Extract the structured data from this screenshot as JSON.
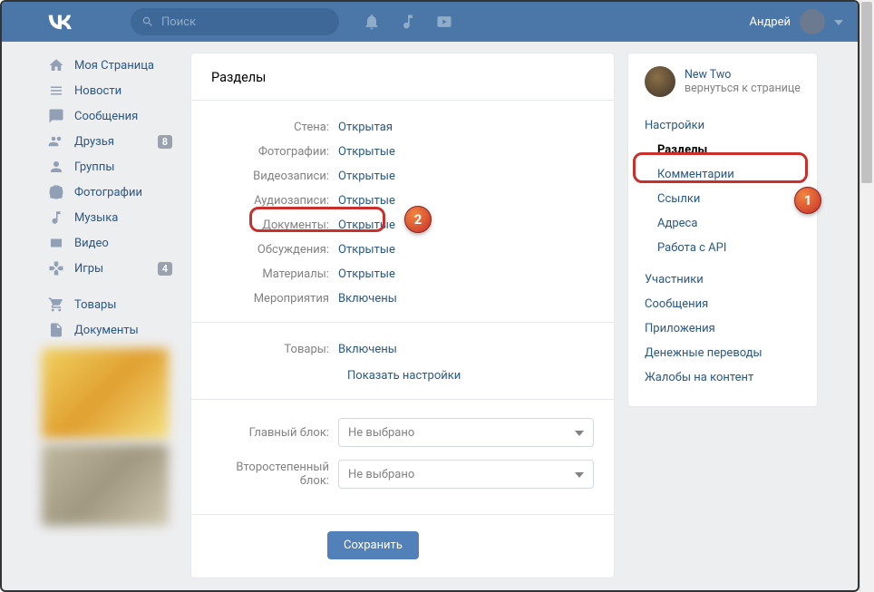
{
  "header": {
    "search_placeholder": "Поиск",
    "user_name": "Андрей"
  },
  "left_nav": {
    "items": [
      {
        "label": "Моя Страница",
        "icon": "home"
      },
      {
        "label": "Новости",
        "icon": "news"
      },
      {
        "label": "Сообщения",
        "icon": "messages"
      },
      {
        "label": "Друзья",
        "icon": "friends",
        "badge": "8"
      },
      {
        "label": "Группы",
        "icon": "groups"
      },
      {
        "label": "Фотографии",
        "icon": "photos"
      },
      {
        "label": "Музыка",
        "icon": "music"
      },
      {
        "label": "Видео",
        "icon": "video"
      },
      {
        "label": "Игры",
        "icon": "games",
        "badge": "4"
      }
    ],
    "items2": [
      {
        "label": "Товары",
        "icon": "market"
      },
      {
        "label": "Документы",
        "icon": "docs"
      }
    ]
  },
  "center": {
    "title": "Разделы",
    "settings": [
      {
        "label": "Стена:",
        "value": "Открытая"
      },
      {
        "label": "Фотографии:",
        "value": "Открытые"
      },
      {
        "label": "Видеозаписи:",
        "value": "Открытые"
      },
      {
        "label": "Аудиозаписи:",
        "value": "Открытые"
      },
      {
        "label": "Документы:",
        "value": "Открытые"
      },
      {
        "label": "Обсуждения:",
        "value": "Открытые"
      },
      {
        "label": "Материалы:",
        "value": "Открытые"
      },
      {
        "label": "Мероприятия",
        "value": "Включены"
      }
    ],
    "products": {
      "label": "Товары:",
      "value": "Включены",
      "show_settings": "Показать настройки"
    },
    "selects": {
      "main": {
        "label": "Главный блок:",
        "value": "Не выбрано"
      },
      "secondary": {
        "label": "Второстепенный блок:",
        "value": "Не выбрано"
      }
    },
    "save": "Сохранить"
  },
  "right": {
    "group_name": "New Two",
    "back_text": "вернуться к странице",
    "items": [
      {
        "label": "Настройки",
        "sub": false,
        "bold": false
      },
      {
        "label": "Разделы",
        "sub": true,
        "bold": true
      },
      {
        "label": "Комментарии",
        "sub": true,
        "bold": false
      },
      {
        "label": "Ссылки",
        "sub": true,
        "bold": false
      },
      {
        "label": "Адреса",
        "sub": true,
        "bold": false
      },
      {
        "label": "Работа с API",
        "sub": true,
        "bold": false
      },
      {
        "label": "Участники",
        "sub": false,
        "bold": false
      },
      {
        "label": "Сообщения",
        "sub": false,
        "bold": false
      },
      {
        "label": "Приложения",
        "sub": false,
        "bold": false
      },
      {
        "label": "Денежные переводы",
        "sub": false,
        "bold": false
      },
      {
        "label": "Жалобы на контент",
        "sub": false,
        "bold": false
      }
    ]
  },
  "markers": {
    "m1": "1",
    "m2": "2"
  }
}
